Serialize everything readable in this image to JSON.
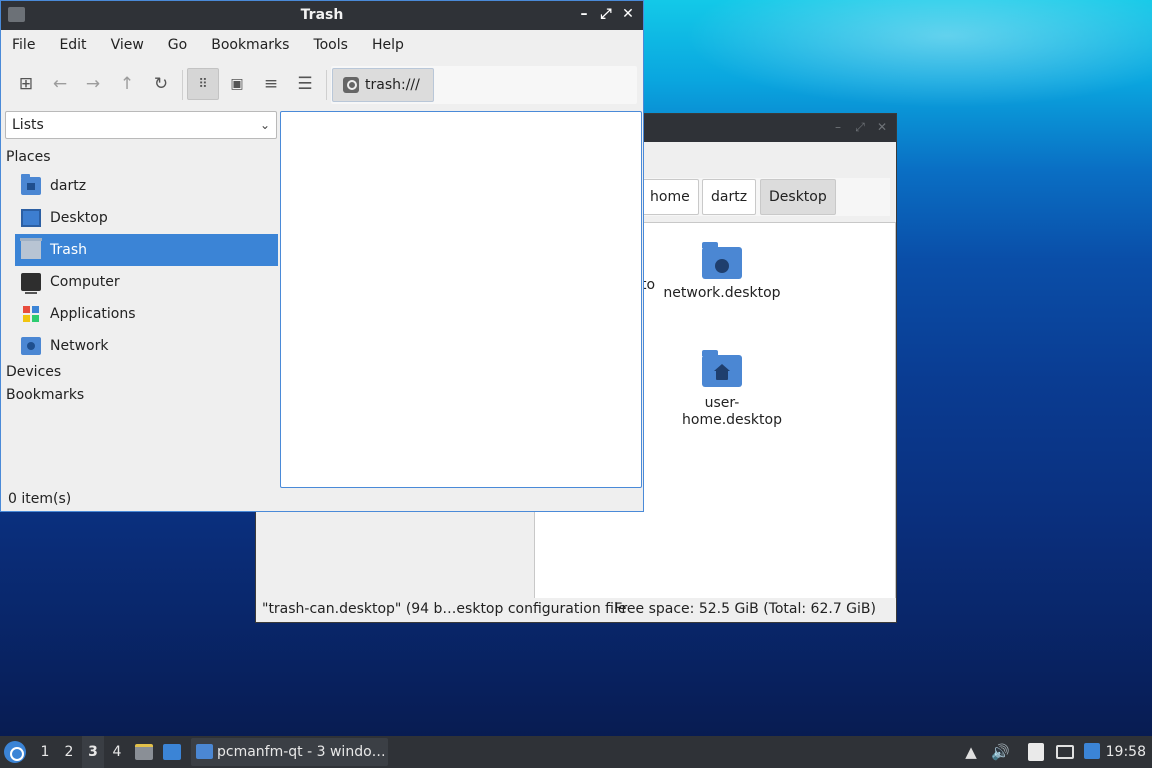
{
  "front_window": {
    "title": "Trash",
    "menu": [
      "File",
      "Edit",
      "View",
      "Go",
      "Bookmarks",
      "Tools",
      "Help"
    ],
    "path": "trash:///",
    "side_combo": "Lists",
    "sections": {
      "places": "Places",
      "devices": "Devices",
      "bookmarks": "Bookmarks"
    },
    "places": [
      {
        "label": "dartz",
        "icon": "home-folder-icon"
      },
      {
        "label": "Desktop",
        "icon": "desktop-icon"
      },
      {
        "label": "Trash",
        "icon": "trash-icon",
        "selected": true
      },
      {
        "label": "Computer",
        "icon": "computer-icon"
      },
      {
        "label": "Applications",
        "icon": "applications-icon"
      },
      {
        "label": "Network",
        "icon": "network-icon"
      }
    ],
    "status": "0 item(s)"
  },
  "back_window": {
    "breadcrumbs": [
      "home",
      "dartz",
      "Desktop"
    ],
    "items": [
      {
        "label": "network.desktop",
        "icon": "network-folder-icon"
      },
      {
        "label": "user-home.desktop",
        "icon": "home-folder-icon"
      }
    ],
    "partial_label": "to",
    "bookmarks_partial": "Bookmarks",
    "status_left": "\"trash-can.desktop\" (94 b…esktop configuration file",
    "status_right": "Free space: 52.5 GiB (Total: 62.7 GiB)"
  },
  "taskbar": {
    "workspaces": [
      "1",
      "2",
      "3",
      "4"
    ],
    "current_workspace": "3",
    "task_label": "pcmanfm-qt - 3 windo…",
    "clock": "19:58"
  },
  "colors": {
    "selection": "#3b84d6",
    "titlebar": "#2f3237",
    "folder": "#4b87d3"
  }
}
